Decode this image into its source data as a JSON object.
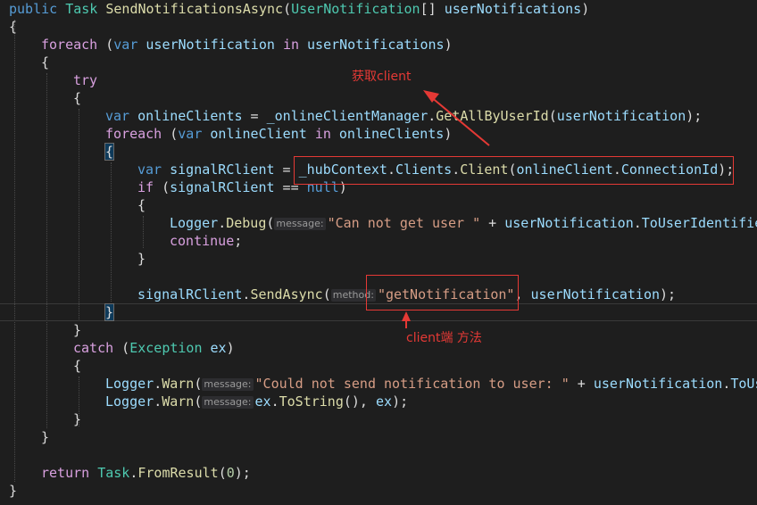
{
  "code": {
    "l1": {
      "kw1": "public",
      "t1": "Task",
      "fn": "SendNotificationsAsync",
      "p1": "(",
      "t2": "UserNotification",
      "p2": "[] ",
      "id": "userNotifications",
      "p3": ")"
    },
    "l2": {
      "p": "{"
    },
    "l3": {
      "kw": "foreach",
      "p1": " (",
      "kw2": "var",
      "id1": " userNotification ",
      "kw3": "in",
      "id2": " userNotifications",
      "p2": ")"
    },
    "l4": {
      "p": "{"
    },
    "l5": {
      "kw": "try"
    },
    "l6": {
      "p": "{"
    },
    "l7": {
      "kw": "var",
      "id1": " onlineClients",
      "p1": " = ",
      "id2": "_onlineClientManager",
      "p2": ".",
      "fn": "GetAllByUserId",
      "p3": "(",
      "id3": "userNotification",
      "p4": ");"
    },
    "l8": {
      "kw": "foreach",
      "p1": " (",
      "kw2": "var",
      "id1": " onlineClient ",
      "kw3": "in",
      "id2": " onlineClients",
      "p2": ")"
    },
    "l9": {
      "p": "{"
    },
    "l10": {
      "kw": "var",
      "id1": " signalRClient",
      "p1": " = ",
      "id2": "_hubContext",
      "p2": ".",
      "id3": "Clients",
      "p3": ".",
      "fn": "Client",
      "p4": "(",
      "id4": "onlineClient",
      "p5": ".",
      "id5": "ConnectionId",
      "p6": ");"
    },
    "l11": {
      "kw": "if",
      "p1": " (",
      "id1": "signalRClient",
      "p2": " == ",
      "kw2": "null",
      "p3": ")"
    },
    "l12": {
      "p": "{"
    },
    "l13": {
      "id1": "Logger",
      "p1": ".",
      "fn": "Debug",
      "p2": "(",
      "hint": "message:",
      "str": "\"Can not get user \"",
      "p3": " + ",
      "id2": "userNotification",
      "p4": ".",
      "id3": "ToUserIdentifier"
    },
    "l14": {
      "kw": "continue",
      "p": ";"
    },
    "l15": {
      "p": "}"
    },
    "l17": {
      "id1": "signalRClient",
      "p1": ".",
      "fn": "SendAsync",
      "p2": "(",
      "hint": "method:",
      "str": "\"getNotification\"",
      "p3": ", ",
      "id2": "userNotification",
      "p4": ");"
    },
    "l18": {
      "p": "}"
    },
    "l19": {
      "p": "}"
    },
    "l20": {
      "kw": "catch",
      "p1": " (",
      "t": "Exception",
      "id": " ex",
      "p2": ")"
    },
    "l21": {
      "p": "{"
    },
    "l22": {
      "id1": "Logger",
      "p1": ".",
      "fn": "Warn",
      "p2": "(",
      "hint": "message:",
      "str": "\"Could not send notification to user: \"",
      "p3": " + ",
      "id2": "userNotification",
      "p4": ".",
      "id3": "ToUs"
    },
    "l23": {
      "id1": "Logger",
      "p1": ".",
      "fn": "Warn",
      "p2": "(",
      "hint": "message:",
      "id2": "ex",
      "p3": ".",
      "fn2": "ToString",
      "p4": "(), ",
      "id3": "ex",
      "p5": ");"
    },
    "l24": {
      "p": "}"
    },
    "l25": {
      "p": "}"
    },
    "l27": {
      "kw": "return",
      "t": " Task",
      "p1": ".",
      "fn": "FromResult",
      "p2": "(",
      "num": "0",
      "p3": ");"
    },
    "l28": {
      "p": "}"
    }
  },
  "annotations": {
    "get_client": "获取client",
    "client_method": "client端 方法",
    "color": "#e53935"
  },
  "theme": {
    "background": "#1e1e1e",
    "keyword": "#569cd6",
    "control": "#d8a0df",
    "type": "#4ec9b0",
    "method": "#dcdcaa",
    "identifier": "#9cdcfe",
    "string": "#d69d85"
  }
}
